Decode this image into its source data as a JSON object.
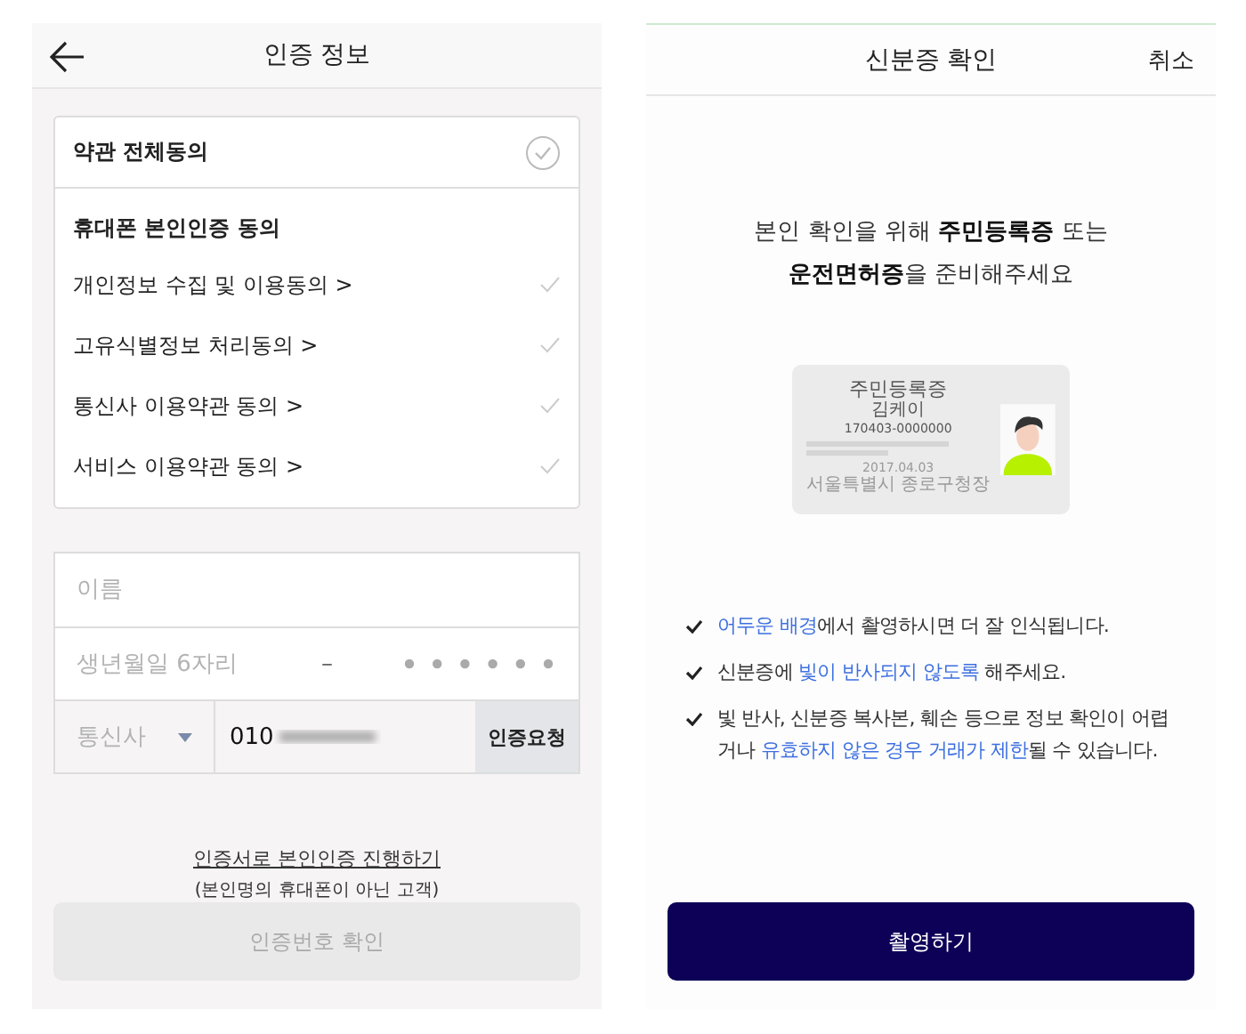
{
  "left_screen": {
    "title": "인증 정보",
    "agreement": {
      "all": {
        "label": "약관 전체동의",
        "checked": false
      },
      "section_title": "휴대폰 본인인증 동의",
      "items": [
        {
          "label": "개인정보 수집 및 이용동의 >",
          "checked": false
        },
        {
          "label": "고유식별정보 처리동의 >",
          "checked": false
        },
        {
          "label": "통신사 이용약관 동의 >",
          "checked": false
        },
        {
          "label": "서비스 이용약관 동의 >",
          "checked": false
        }
      ]
    },
    "form": {
      "name": {
        "placeholder": "이름"
      },
      "birth": {
        "placeholder": "생년월일 6자리",
        "separator": "–"
      },
      "carrier": {
        "placeholder": "통신사"
      },
      "phone": {
        "value": "010"
      },
      "request_button": "인증요청"
    },
    "alt_link": "인증서로 본인인증 진행하기",
    "alt_note": "(본인명의 휴대폰이 아닌 고객)",
    "confirm_button": {
      "label": "인증번호 확인",
      "disabled": true
    }
  },
  "right_screen": {
    "title": "신분증 확인",
    "cancel": "취소",
    "intro": [
      "본인 확인을 위해 **주민등록증** 또는",
      "**운전면허증**을 준비해주세요"
    ],
    "id_card": {
      "title": "주민등록증",
      "name": "김케이",
      "number": "170403-0000000",
      "date": "2017.04.03",
      "issuer": "서울특별시 종로구청장"
    },
    "tips": [
      [
        {
          "text": "어두운 배경",
          "highlight": true
        },
        {
          "text": "에서 촬영하시면 더 잘 인식됩니다.",
          "highlight": false
        }
      ],
      [
        {
          "text": "신분증에 ",
          "highlight": false
        },
        {
          "text": "빛이 반사되지 않도록",
          "highlight": true
        },
        {
          "text": " 해주세요.",
          "highlight": false
        }
      ],
      [
        {
          "text": "빛 반사, 신분증 복사본, 훼손 등으로 정보 확인이 어렵거나 ",
          "highlight": false
        },
        {
          "text": "유효하지 않은 경우 거래가 제한",
          "highlight": true
        },
        {
          "text": "될 수 있습니다.",
          "highlight": false
        }
      ]
    ],
    "shoot_button": "촬영하기"
  }
}
